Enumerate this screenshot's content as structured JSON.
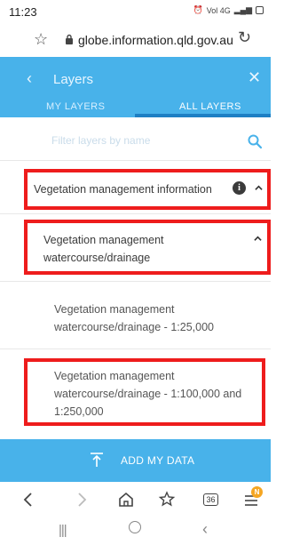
{
  "status_bar": {
    "time": "11:23",
    "signal_text": "Vol 4G"
  },
  "browser": {
    "url": "globe.information.qld.gov.au"
  },
  "panel": {
    "title": "Layers",
    "tabs": [
      {
        "label": "MY LAYERS",
        "active": false
      },
      {
        "label": "ALL LAYERS",
        "active": true
      }
    ],
    "filter_placeholder": "Filter layers by name"
  },
  "layers": [
    {
      "label": "Vegetation management information",
      "has_info": true,
      "expanded": true,
      "highlighted": true
    },
    {
      "label": "Vegetation management watercourse/drainage",
      "expanded": true,
      "highlighted": true
    },
    {
      "label": "Vegetation management watercourse/drainage - 1:25,000",
      "highlighted": false
    },
    {
      "label": "Vegetation management watercourse/drainage - 1:100,000 and 1:250,000",
      "highlighted": true
    }
  ],
  "add_data": {
    "label": "ADD MY DATA"
  },
  "nav": {
    "tab_count": "36",
    "notification_badge": "N"
  },
  "colors": {
    "accent": "#48b2ea",
    "tab_underline": "#1e7fc4",
    "highlight": "#ee1c1c",
    "badge": "#f5a623"
  }
}
